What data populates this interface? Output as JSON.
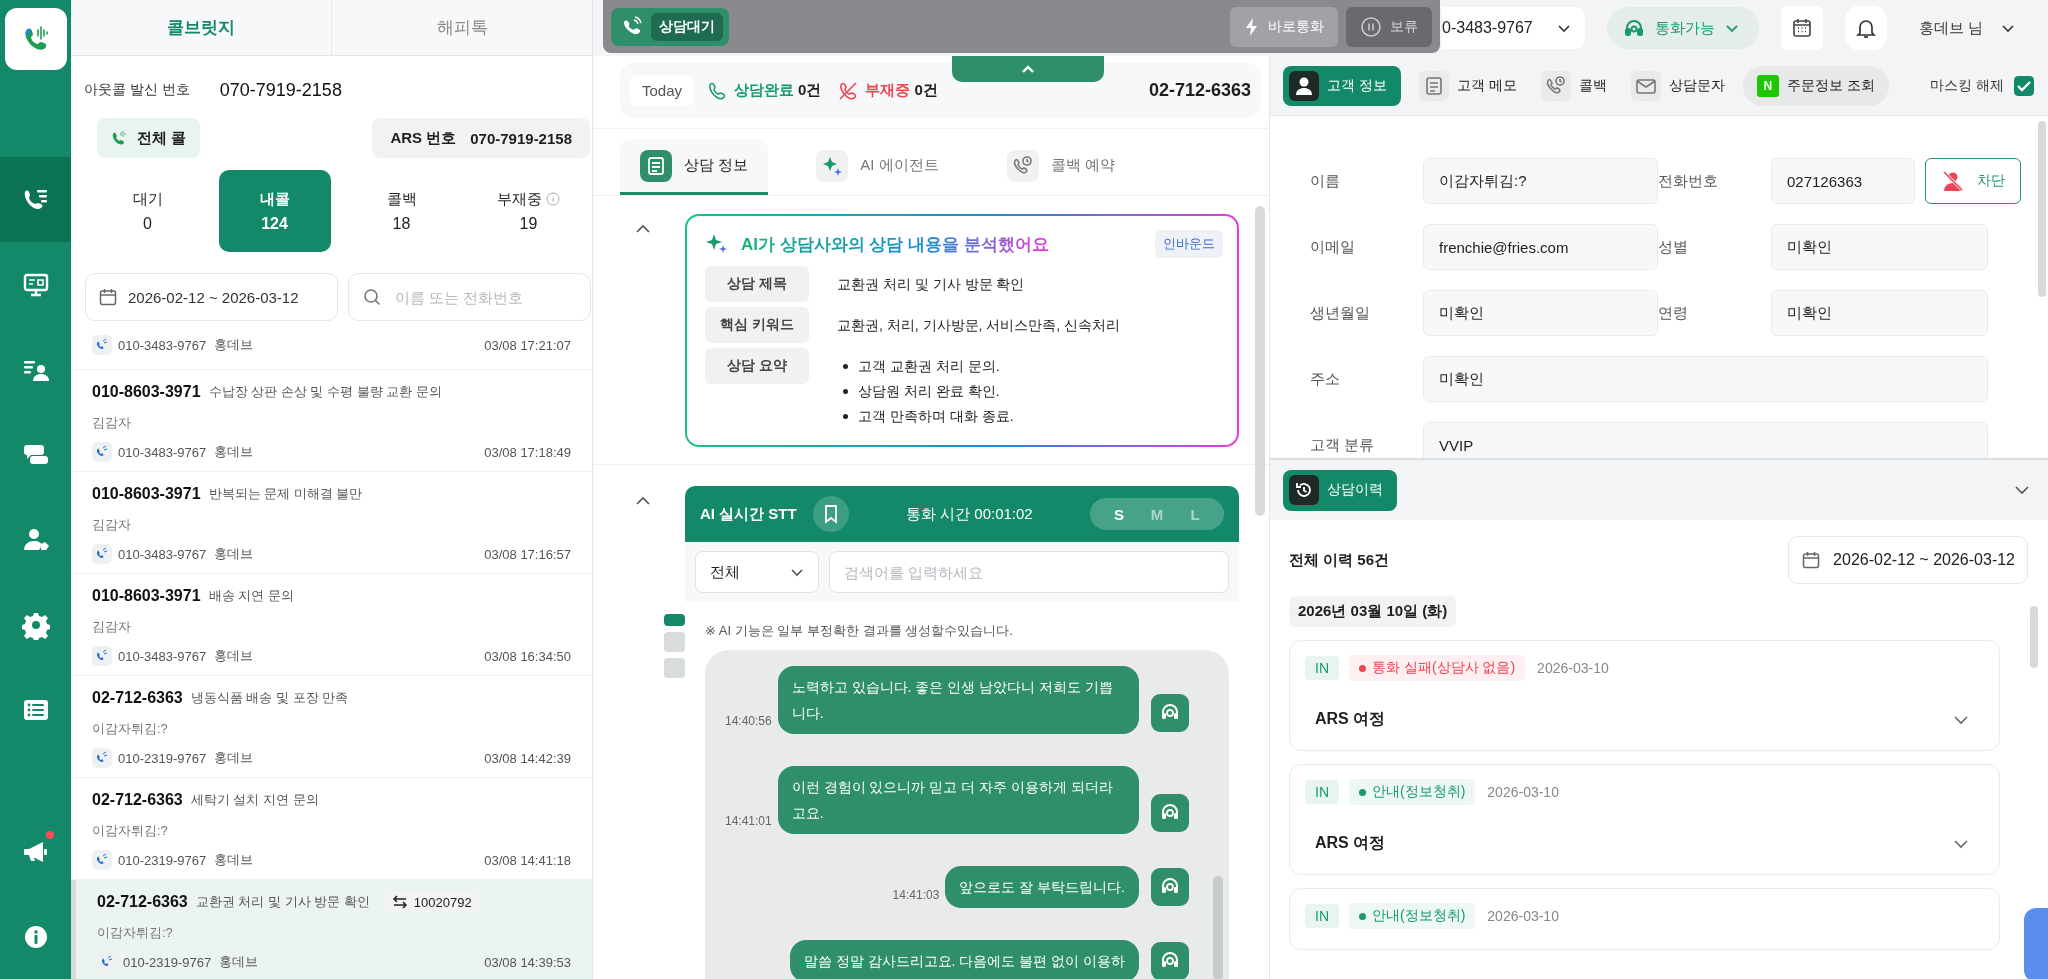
{
  "rail_items": [
    {
      "kind": "calls",
      "selected": true
    },
    {
      "kind": "monitor",
      "selected": false
    },
    {
      "kind": "contacts",
      "selected": false
    },
    {
      "kind": "chat",
      "selected": false
    },
    {
      "kind": "users",
      "selected": false
    },
    {
      "kind": "settings",
      "selected": false
    },
    {
      "kind": "list",
      "selected": false
    }
  ],
  "rail_bottom": [
    {
      "kind": "megaphone",
      "badge": true
    },
    {
      "kind": "info",
      "badge": false
    }
  ],
  "top_tabs": [
    {
      "label": "콜브릿지",
      "selected": true
    },
    {
      "label": "해피톡",
      "selected": false
    }
  ],
  "outcall": {
    "label": "아웃콜 발신 번호",
    "number": "070-7919-2158"
  },
  "all_calls_button": "전체 콜",
  "ars": {
    "label": "ARS 번호",
    "number": "070-7919-2158"
  },
  "counters": [
    {
      "label": "대기",
      "count": "0",
      "selected": false,
      "info": false
    },
    {
      "label": "내콜",
      "count": "124",
      "selected": true,
      "info": false
    },
    {
      "label": "콜백",
      "count": "18",
      "selected": false,
      "info": false
    },
    {
      "label": "부재중",
      "count": "19",
      "selected": false,
      "info": true
    }
  ],
  "date_range": "2026-02-12 ~ 2026-03-12",
  "search": {
    "placeholder": "이름 또는 전화번호"
  },
  "calls": [
    {
      "agent_phone": "010-3483-9767",
      "agent": "홍데브",
      "time": "03/08 17:21:07",
      "selected": false
    },
    {
      "phone": "010-8603-3971",
      "subject": "수납장 상판 손상 및 수평 불량 교환 문의",
      "customer": "김감자",
      "agent_phone": "010-3483-9767",
      "agent": "홍데브",
      "time": "03/08 17:18:49",
      "selected": false
    },
    {
      "phone": "010-8603-3971",
      "subject": "반복되는 문제 미해결 불만",
      "customer": "김감자",
      "agent_phone": "010-3483-9767",
      "agent": "홍데브",
      "time": "03/08 17:16:57",
      "selected": false
    },
    {
      "phone": "010-8603-3971",
      "subject": "배송 지연 문의",
      "customer": "김감자",
      "agent_phone": "010-3483-9767",
      "agent": "홍데브",
      "time": "03/08 16:34:50",
      "selected": false
    },
    {
      "phone": "02-712-6363",
      "subject": "냉동식품 배송 및 포장 만족",
      "customer": "이감자튀김:?",
      "agent_phone": "010-2319-9767",
      "agent": "홍데브",
      "time": "03/08 14:42:39",
      "selected": false
    },
    {
      "phone": "02-712-6363",
      "subject": "세탁기 설치 지연 문의",
      "customer": "이감자튀김:?",
      "agent_phone": "010-2319-9767",
      "agent": "홍데브",
      "time": "03/08 14:41:18",
      "selected": false
    },
    {
      "phone": "02-712-6363",
      "subject": "교환권 처리 및 기사 방문 확인",
      "ticket": "10020792",
      "customer": "이감자튀김:?",
      "agent_phone": "010-2319-9767",
      "agent": "홍데브",
      "time": "03/08 14:39:53",
      "selected": true
    }
  ],
  "call_bar": {
    "status": "상담대기",
    "buttons": [
      {
        "label": "바로통화",
        "kind": "bolt",
        "disabled": false
      },
      {
        "label": "보류",
        "kind": "pause",
        "disabled": true
      }
    ]
  },
  "topbar": {
    "line_select": "0-3483-9767",
    "status": "통화가능",
    "user": "홍데브 님"
  },
  "today": {
    "label": "Today",
    "done_label": "상담완료",
    "done_count": "0건",
    "missed_label": "부재중",
    "missed_count": "0건",
    "phone": "02-712-6363"
  },
  "mid_tabs": [
    {
      "label": "상담 정보",
      "kind": "doc",
      "selected": true
    },
    {
      "label": "AI 에이전트",
      "kind": "sparkle",
      "selected": false
    },
    {
      "label": "콜백 예약",
      "kind": "callback",
      "selected": false
    }
  ],
  "ai_summary": {
    "title": "AI가 상담사와의 상담 내용을 분석했어요",
    "tag": "인바운드",
    "rows": [
      {
        "label": "상담 제목",
        "value": "교환권 처리 및 기사 방문 확인"
      },
      {
        "label": "핵심 키워드",
        "value": "교환권, 처리, 기사방문, 서비스만족, 신속처리"
      },
      {
        "label": "상담 요약",
        "bullets": [
          "고객 교환권 처리 문의.",
          "상담원 처리 완료 확인.",
          "고객 만족하며 대화 종료."
        ]
      }
    ]
  },
  "stt": {
    "title": "AI 실시간 STT",
    "call_time": "통화 시간 00:01:02",
    "sizes": [
      {
        "label": "S",
        "selected": true
      },
      {
        "label": "M",
        "selected": false
      },
      {
        "label": "L",
        "selected": false
      }
    ],
    "filter": "전체",
    "search_placeholder": "검색어를 입력하세요",
    "views": [
      {
        "selected": true
      },
      {
        "selected": false
      },
      {
        "selected": false
      }
    ],
    "notice": "※ AI 기능은 일부 부정확한 결과를 생성할수있습니다.",
    "messages": [
      {
        "time": "14:40:56",
        "text": "노력하고 있습니다. 좋은 인생 남았다니 저희도 기쁩니다."
      },
      {
        "time": "14:41:01",
        "text": "이런 경험이 있으니까 믿고 더 자주 이용하게 되더라고요."
      },
      {
        "time": "14:41:03",
        "text": "앞으로도 잘 부탁드립니다."
      },
      {
        "text": "말씀 정말 감사드리고요. 다음에도 불편 없이 이용하"
      }
    ]
  },
  "right_tabs": [
    {
      "label": "고객 정보",
      "kind": "person",
      "selected": true
    },
    {
      "label": "고객 메모",
      "kind": "memo",
      "selected": false
    },
    {
      "label": "콜백",
      "kind": "callback",
      "selected": false
    },
    {
      "label": "상담문자",
      "kind": "mail",
      "selected": false
    },
    {
      "label": "주문정보 조회",
      "kind": "store",
      "icon_text": "N",
      "selected": false
    }
  ],
  "masking": {
    "label": "마스킹 해제",
    "checked": true
  },
  "customer_fields": [
    {
      "label": "이름",
      "value": "이감자튀김:?",
      "wide": false
    },
    {
      "label": "전화번호",
      "value": "027126363",
      "wide": false,
      "block_button": "차단"
    },
    {
      "label": "이메일",
      "value": "frenchie@fries.com",
      "wide": false
    },
    {
      "label": "성별",
      "value": "미확인",
      "wide": false
    },
    {
      "label": "생년월일",
      "value": "미확인",
      "wide": false
    },
    {
      "label": "연령",
      "value": "미확인",
      "wide": false
    },
    {
      "label": "주소",
      "value": "미확인",
      "wide": true
    },
    {
      "label": "고객 분류",
      "value": "VVIP",
      "wide": true
    }
  ],
  "history": {
    "title": "상담이력",
    "total": "전체 이력 56건",
    "date_range": "2026-02-12 ~ 2026-03-12",
    "date": "2026년 03월 10일 (화)",
    "entries": [
      {
        "direction": "IN",
        "status": "통화 실패(상담사 없음)",
        "color": "#f04452",
        "date": "2026-03-10",
        "title": "ARS 여정"
      },
      {
        "direction": "IN",
        "status": "안내(정보청취)",
        "color": "#1a9a6c",
        "date": "2026-03-10",
        "title": "ARS 여정"
      },
      {
        "direction": "IN",
        "status": "안내(정보청취)",
        "color": "#1a9a6c",
        "date": "2026-03-10"
      }
    ]
  }
}
